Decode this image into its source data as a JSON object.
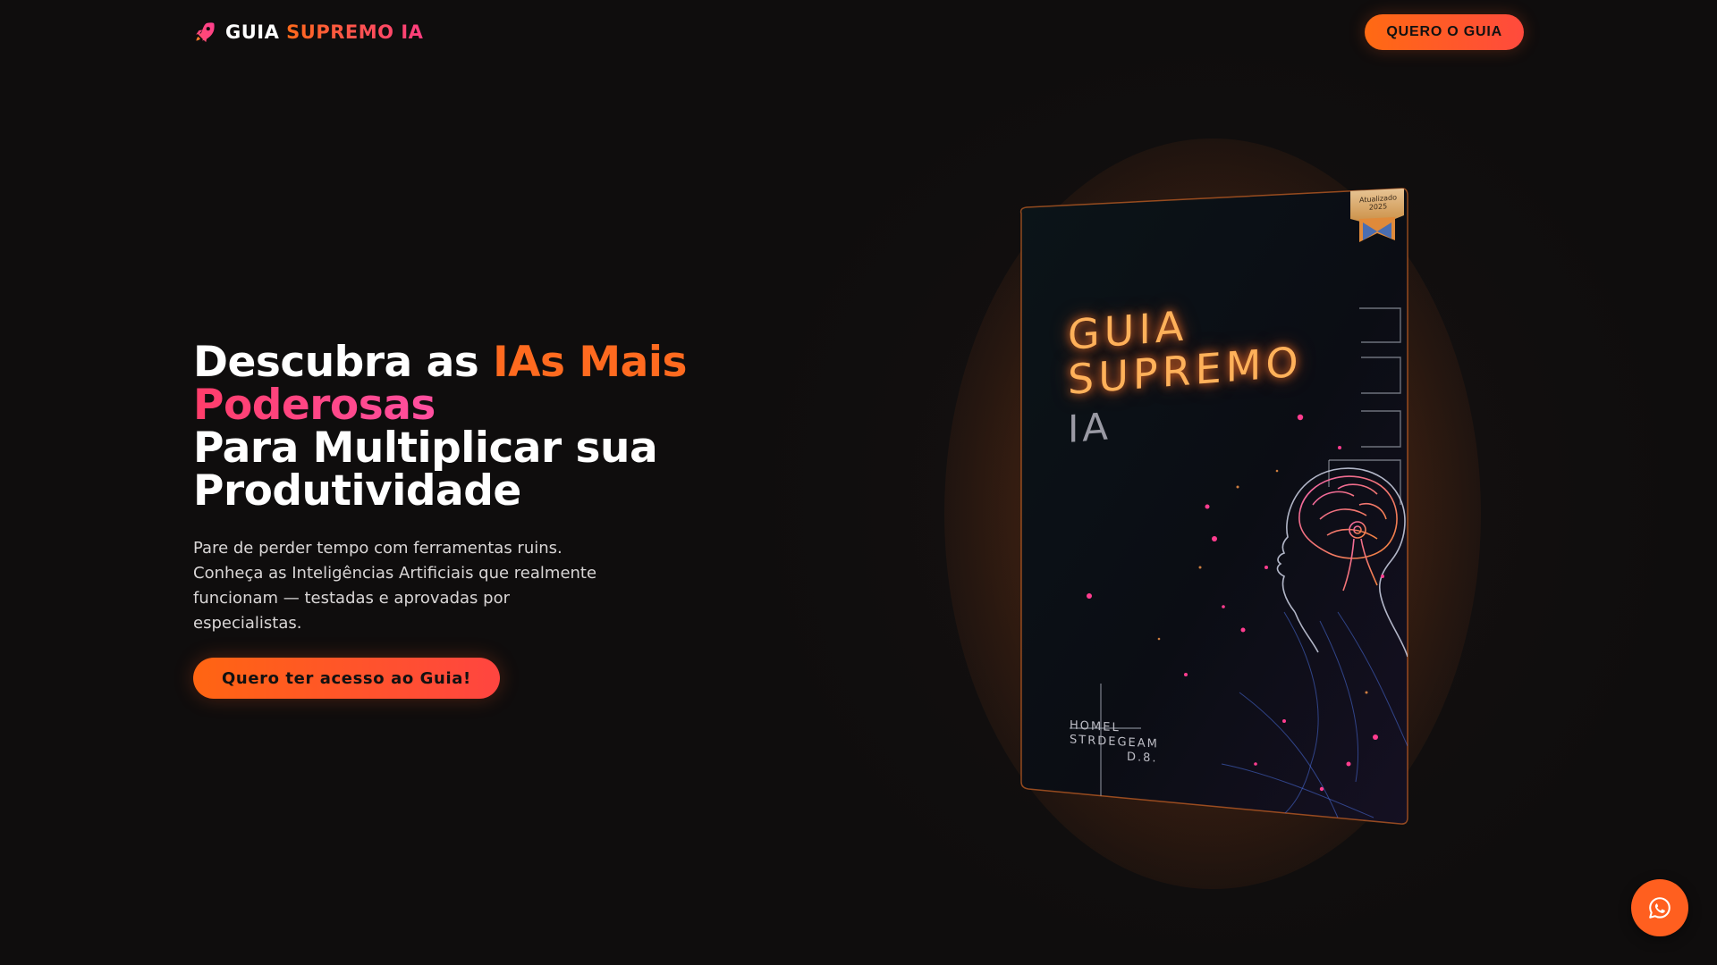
{
  "header": {
    "brand_main": "GUIA",
    "brand_accent": "SUPREMO IA",
    "cta_label": "QUERO O GUIA"
  },
  "hero": {
    "headline_1": "Descubra as",
    "headline_accent_1": "IAs Mais",
    "headline_accent_2": "Poderosas",
    "headline_3": "Para Multiplicar sua",
    "headline_4": "Produtividade",
    "description": "Pare de perder tempo com ferramentas ruins. Conheça as Inteligências Artificiais que realmente funcionam — testadas e aprovadas por especialistas.",
    "cta_label": "Quero ter acesso ao Guia!"
  },
  "book": {
    "title_line_1": "GUIA",
    "title_line_2": "SUPREMO",
    "title_line_3": "IA",
    "badge_line_1": "Atualizado",
    "badge_line_2": "2025",
    "author_line_1": "HOMEL",
    "author_line_2": "STRDEGEAM",
    "author_line_3": "D.8."
  },
  "icons": {
    "brand": "rocket-icon",
    "floating": "whatsapp-icon"
  },
  "colors": {
    "accent_orange": "#ff6a1f",
    "accent_pink": "#ff3d7f",
    "background": "#0f0d0d"
  }
}
